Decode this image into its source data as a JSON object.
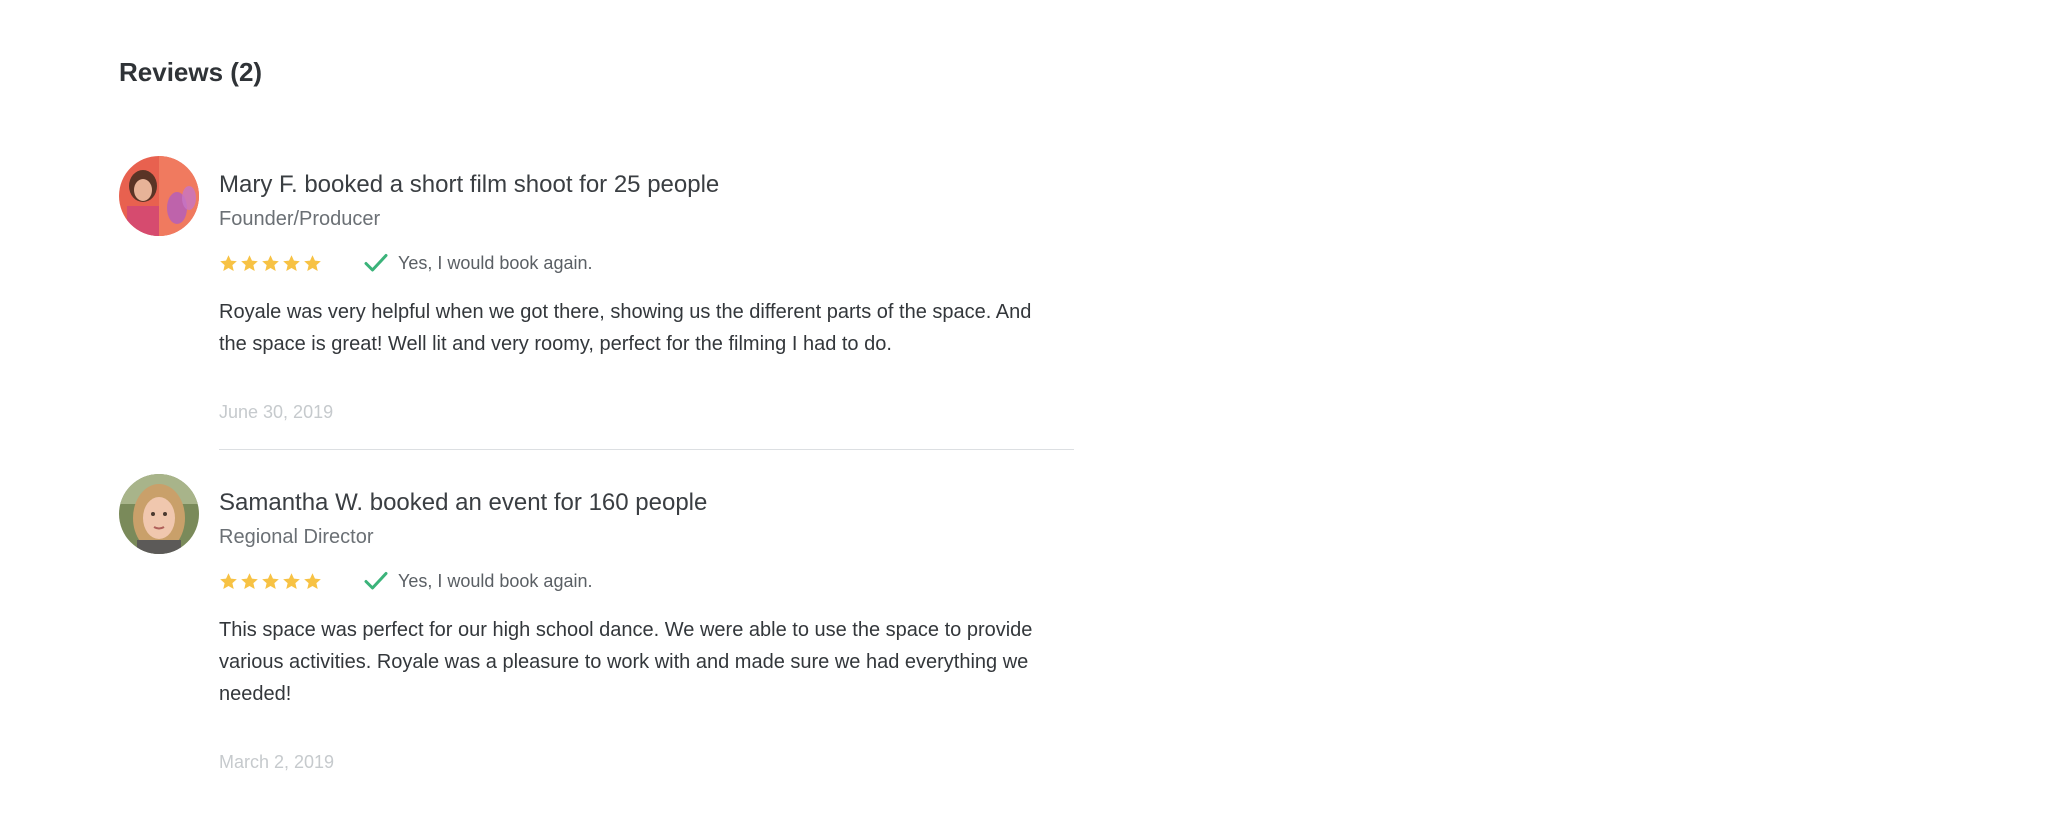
{
  "reviews": {
    "heading": "Reviews (2)",
    "items": [
      {
        "reviewer_line": "Mary F. booked a short film shoot for 25 people",
        "role": "Founder/Producer",
        "rating": 5,
        "book_again": "Yes, I would book again.",
        "text": "Royale was very helpful when we got there, showing us the different parts of the space. And the space is great! Well lit and very roomy, perfect for the filming I had to do.",
        "date": "June 30, 2019"
      },
      {
        "reviewer_line": "Samantha W. booked an event for 160 people",
        "role": "Regional Director",
        "rating": 5,
        "book_again": "Yes, I would book again.",
        "text": "This space was perfect for our high school dance. We were able to use the space to provide various activities. Royale was a pleasure to work with and made sure we had everything we needed!",
        "date": "March 2, 2019"
      }
    ]
  },
  "colors": {
    "star": "#f7c244",
    "check": "#3bb37a",
    "date": "#c6cacd",
    "divider": "#dcdfe2"
  }
}
